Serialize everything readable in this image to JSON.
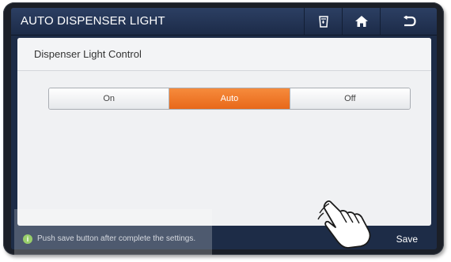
{
  "titlebar": {
    "title": "AUTO DISPENSER LIGHT",
    "buttons": [
      {
        "icon": "dispenser-icon"
      },
      {
        "icon": "home-icon"
      },
      {
        "icon": "back-icon"
      }
    ]
  },
  "panel": {
    "title": "Dispenser Light Control",
    "options": [
      "On",
      "Auto",
      "Off"
    ],
    "selected": "Auto"
  },
  "statusbar": {
    "icon": "info-icon",
    "icon_glyph": "i",
    "message": "Push save button after complete the settings.",
    "save_label": "Save"
  },
  "colors": {
    "accent": "#f07a2a",
    "titlebar": "#1d2c47",
    "info": "#7cc142"
  }
}
